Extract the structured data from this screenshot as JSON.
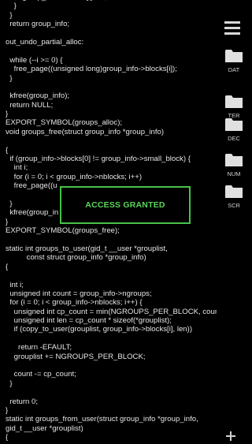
{
  "code_lines": [
    "        group_info->blocks[i] = b;",
    "    }",
    "  }",
    "  return group_info;",
    "",
    "out_undo_partial_alloc:",
    "",
    "  while (--i >= 0) {",
    "    free_page((unsigned long)group_info->blocks[i]);",
    "  }",
    "",
    "  kfree(group_info);",
    "  return NULL;",
    "}",
    "EXPORT_SYMBOL(groups_alloc);",
    "void groups_free(struct group_info *group_info)",
    "",
    "{",
    "  if (group_info->blocks[0] != group_info->small_block) {",
    "    int i;",
    "    for (i = 0; i < group_info->nblocks; i++)",
    "    free_page((u",
    "",
    "  }",
    "  kfree(group_in",
    "}",
    "EXPORT_SYMBOL(groups_free);",
    "",
    "static int groups_to_user(gid_t __user *grouplist,",
    "          const struct group_info *group_info)",
    "{",
    "",
    "  int i;",
    "  unsigned int count = group_info->ngroups;",
    "  for (i = 0; i < group_info->nblocks; i++) {",
    "    unsigned int cp_count = min(NGROUPS_PER_BLOCK, count);",
    "    unsigned int len = cp_count * sizeof(*grouplist);",
    "    if (copy_to_user(grouplist, group_info->blocks[i], len))",
    "",
    "      return -EFAULT;",
    "    grouplist += NGROUPS_PER_BLOCK;",
    "",
    "    count -= cp_count;",
    "  }",
    "",
    "  return 0;",
    "}",
    "static int groups_from_user(struct group_info *group_info,",
    "gid_t __user *grouplist)",
    "{"
  ],
  "overlay": {
    "message": "ACCESS GRANTED"
  },
  "sidebar": {
    "menu_icon": "hamburger-menu-icon",
    "folders": [
      {
        "label": "DAT",
        "icon": "folder-icon"
      },
      {
        "label": "TER",
        "icon": "folder-icon"
      },
      {
        "label": "DEC",
        "icon": "folder-icon"
      },
      {
        "label": "NUM",
        "icon": "folder-icon"
      },
      {
        "label": "SCR",
        "icon": "folder-icon"
      }
    ],
    "add_icon": "plus-icon"
  },
  "colors": {
    "background": "#000000",
    "code_text": "#e6e6e6",
    "accent_green": "#48c248",
    "icon_gray": "#d0d0d0"
  }
}
